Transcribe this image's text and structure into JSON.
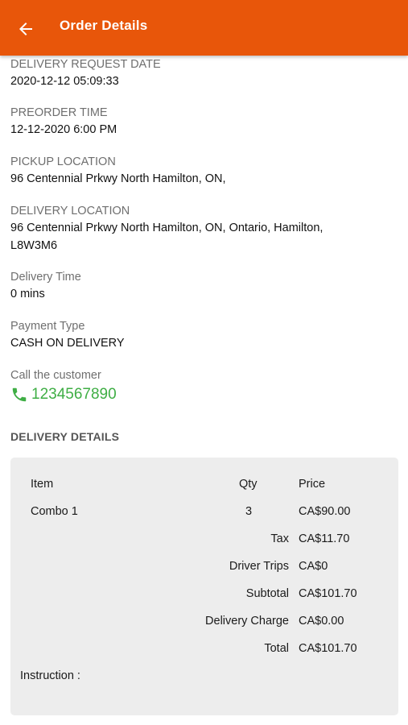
{
  "header": {
    "title": "Order Details",
    "back_icon": "arrow-left-icon"
  },
  "fields": {
    "delivery_request_date": {
      "label": "DELIVERY REQUEST DATE",
      "value": "2020-12-12 05:09:33"
    },
    "preorder_time": {
      "label": "PREORDER TIME",
      "value": "12-12-2020 6:00 PM"
    },
    "pickup_location": {
      "label": "PICKUP LOCATION",
      "value": "96 Centennial Prkwy North Hamilton, ON,"
    },
    "delivery_location": {
      "label": "DELIVERY LOCATION",
      "value_line1": "96 Centennial Prkwy North Hamilton, ON, Ontario, Hamilton,",
      "value_line2": "L8W3M6"
    },
    "delivery_time": {
      "label": "Delivery Time",
      "value": "0 mins"
    },
    "payment_type": {
      "label": "Payment Type",
      "value": "CASH ON DELIVERY"
    },
    "call_customer": {
      "label": "Call the customer",
      "phone": "1234567890",
      "icon": "phone-icon"
    }
  },
  "delivery_details": {
    "title": "DELIVERY DETAILS",
    "columns": {
      "item": "Item",
      "qty": "Qty",
      "price": "Price"
    },
    "items": [
      {
        "name": "Combo 1",
        "qty": "3",
        "price": "CA$90.00"
      }
    ],
    "summary": [
      {
        "label": "Tax",
        "value": "CA$11.70"
      },
      {
        "label": "Driver Trips",
        "value": "CA$0"
      },
      {
        "label": "Subtotal",
        "value": "CA$101.70"
      },
      {
        "label": "Delivery Charge",
        "value": "CA$0.00"
      },
      {
        "label": "Total",
        "value": "CA$101.70"
      }
    ],
    "instruction_label": "Instruction :"
  },
  "colors": {
    "appbar": "#e8560a",
    "phone": "#3fae45",
    "card": "#ededed"
  }
}
